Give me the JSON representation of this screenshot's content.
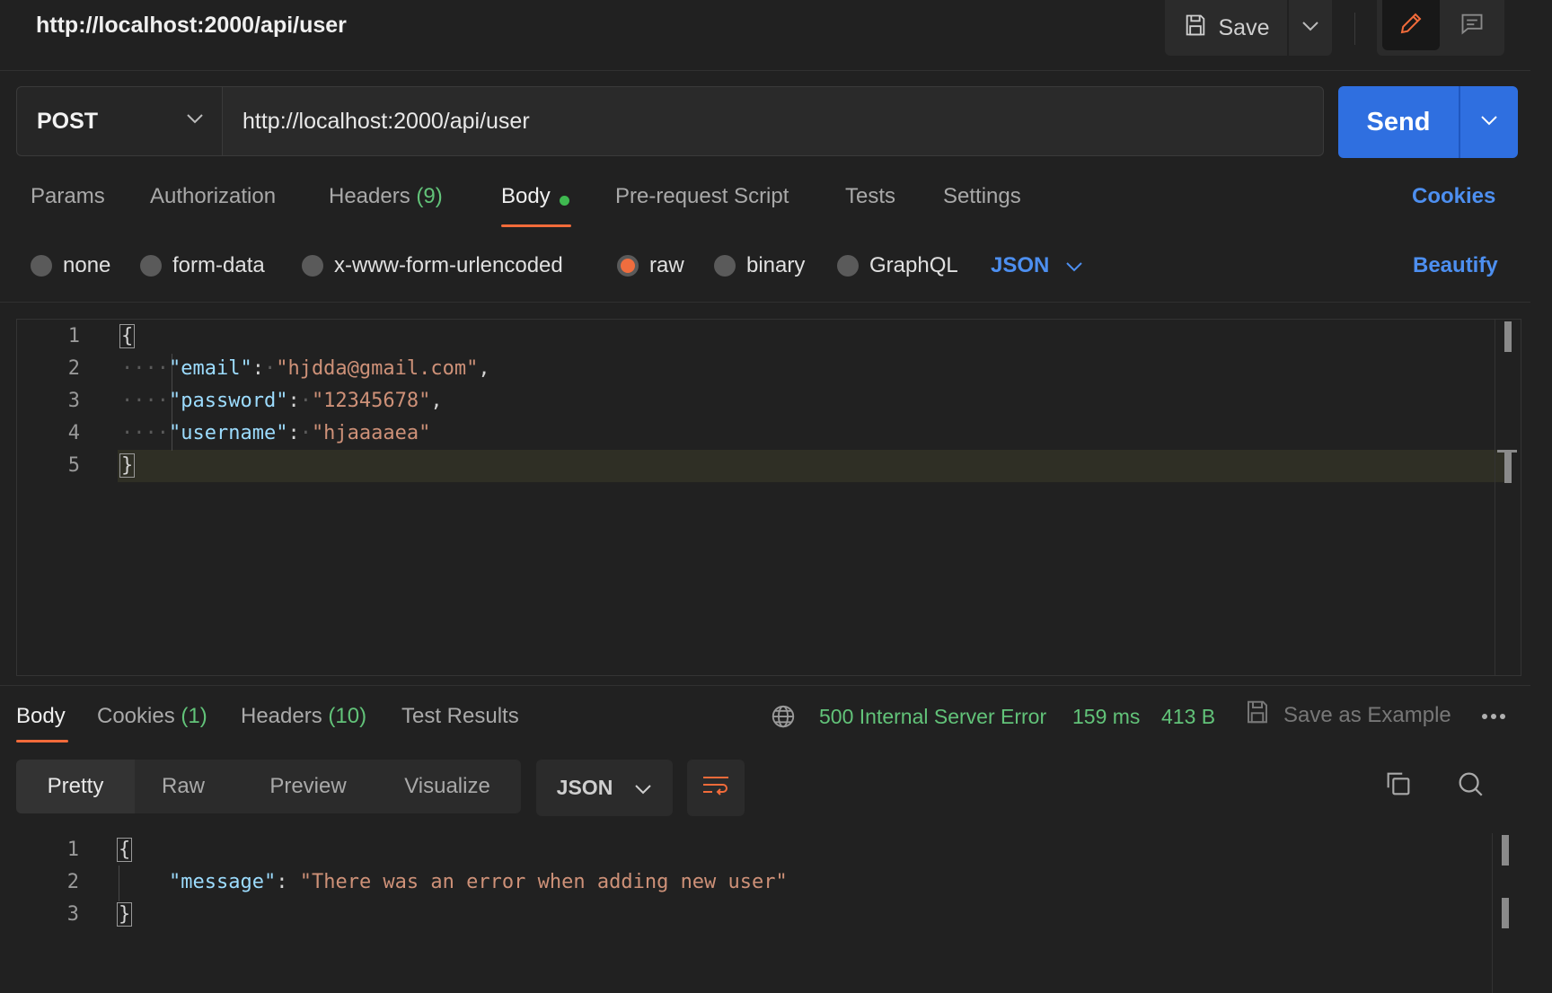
{
  "header": {
    "title": "http://localhost:2000/api/user",
    "save_label": "Save"
  },
  "request": {
    "method": "POST",
    "url": "http://localhost:2000/api/user",
    "send_label": "Send"
  },
  "tabs": {
    "params": "Params",
    "authorization": "Authorization",
    "headers": "Headers",
    "headers_count": "(9)",
    "body": "Body",
    "pre_request": "Pre-request Script",
    "tests": "Tests",
    "settings": "Settings",
    "cookies": "Cookies"
  },
  "body_types": {
    "none": "none",
    "form_data": "form-data",
    "urlencoded": "x-www-form-urlencoded",
    "raw": "raw",
    "binary": "binary",
    "graphql": "GraphQL",
    "format": "JSON",
    "beautify": "Beautify"
  },
  "editor": {
    "line_numbers": [
      "1",
      "2",
      "3",
      "4",
      "5"
    ],
    "open_brace": "{",
    "close_brace": "}",
    "key_email": "\"email\"",
    "val_email": "\"hjdda@gmail.com\"",
    "key_password": "\"password\"",
    "val_password": "\"12345678\"",
    "key_username": "\"username\"",
    "val_username": "\"hjaaaaea\""
  },
  "response": {
    "tabs": {
      "body": "Body",
      "cookies": "Cookies",
      "cookies_count": "(1)",
      "headers": "Headers",
      "headers_count": "(10)",
      "test_results": "Test Results"
    },
    "status": "500 Internal Server Error",
    "time": "159 ms",
    "size": "413 B",
    "save_example": "Save as Example",
    "views": {
      "pretty": "Pretty",
      "raw": "Raw",
      "preview": "Preview",
      "visualize": "Visualize"
    },
    "format": "JSON",
    "line_numbers": [
      "1",
      "2",
      "3"
    ],
    "open_brace": "{",
    "close_brace": "}",
    "key_message": "\"message\"",
    "val_message": "\"There was an error when adding new user\""
  },
  "colors": {
    "accent": "#f26b3a",
    "send": "#2f6fe0",
    "link": "#4d8ff0",
    "success": "#62c379"
  },
  "icons": [
    "save-icon",
    "chevron-down-icon",
    "pencil-icon",
    "comment-icon",
    "globe-icon",
    "more-icon",
    "wrap-lines-icon",
    "copy-icon",
    "search-icon"
  ]
}
